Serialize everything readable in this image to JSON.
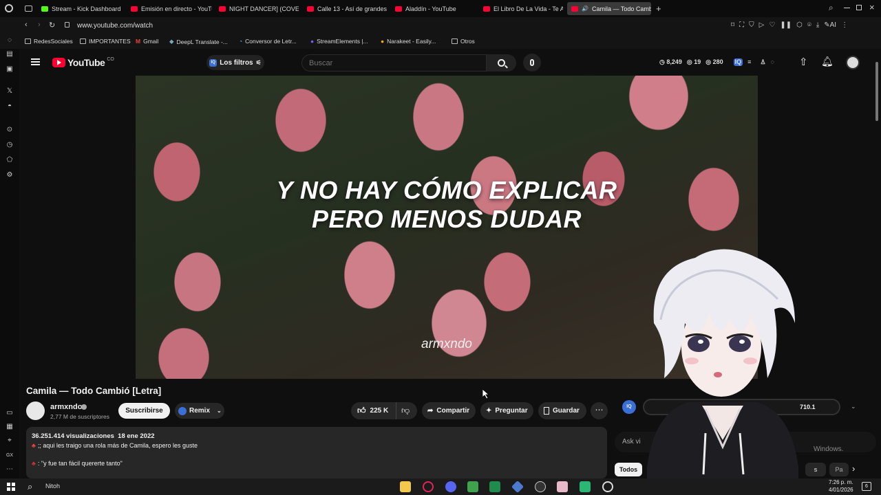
{
  "tabs": [
    {
      "label": "Stream - Kick Dashboard"
    },
    {
      "label": "Emisión en directo - YouTu"
    },
    {
      "label": "NIGHT DANCER] (COVER"
    },
    {
      "label": "Calle 13 - Así de grandes"
    },
    {
      "label": "Aladdín - YouTube"
    },
    {
      "label": "El Libro De La Vida - Te A"
    },
    {
      "label": "Camila — Todo Cambi"
    }
  ],
  "address": {
    "url": "www.youtube.com/watch"
  },
  "bookmarks": [
    "RedesSociales",
    "IMPORTANTES",
    "Gmail",
    "DeepL Translate -...",
    "Conversor de Letr...",
    "StreamElements |...",
    "Narakeet - Easily...",
    "Otros"
  ],
  "youtube": {
    "logo": "YouTube",
    "region": "CO",
    "filters_label": "Los filtros",
    "search_placeholder": "Buscar",
    "stats": {
      "a": "8,249",
      "b": "19",
      "c": "280"
    }
  },
  "video": {
    "lyric_line1": "Y NO HAY CÓMO EXPLICAR",
    "lyric_line2": "PERO MENOS DUDAR",
    "watermark": "armxndo"
  },
  "meta": {
    "title": "Camila — Todo Cambió [Letra]",
    "channel": "armxndo",
    "subscribers": "2,77 M de suscriptores",
    "subscribe": "Suscribirse",
    "remix": "Remix",
    "likes": "225 K",
    "share": "Compartir",
    "ask": "Preguntar",
    "save": "Guardar",
    "views_date": "36.251.414 visualizaciones  18 ene 2022",
    "desc1": ";; aqui les traigo una rola más de Camila, espero les guste",
    "desc2": ": \"y fue tan fácil quererte tanto\""
  },
  "side": {
    "value": "710.1",
    "ask_placeholder": "Ask vi",
    "chip_all": "Todos",
    "chip_2": "Pa",
    "chip_3": "s",
    "windows_watermark": "Windows."
  },
  "taskbar": {
    "search": "Nitoh",
    "time": "7:26 p. m.",
    "date": "4/01/2026",
    "notif": "6"
  }
}
